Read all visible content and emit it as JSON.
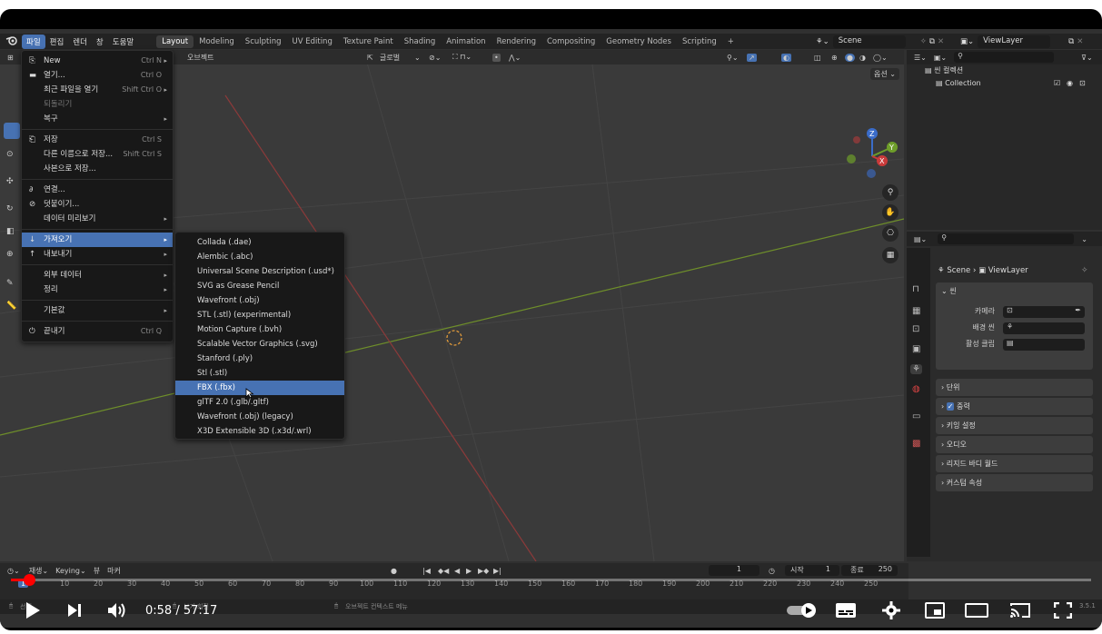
{
  "topbar": {
    "menus": [
      "파일",
      "편집",
      "렌더",
      "창",
      "도움말"
    ],
    "workspaces": [
      "Layout",
      "Modeling",
      "Sculpting",
      "UV Editing",
      "Texture Paint",
      "Shading",
      "Animation",
      "Rendering",
      "Compositing",
      "Geometry Nodes",
      "Scripting",
      "+"
    ],
    "scene": "Scene",
    "view_layer": "ViewLayer"
  },
  "viewport": {
    "object_menu": "오브젝트",
    "orientation": "글로벌",
    "options": "옵션"
  },
  "file_menu": {
    "items": [
      {
        "label": "New",
        "shortcut": "Ctrl N",
        "arrow": "▸"
      },
      {
        "label": "열기...",
        "shortcut": "Ctrl O"
      },
      {
        "label": "최근 파일을 열기",
        "shortcut": "Shift Ctrl O",
        "arrow": "▸"
      },
      {
        "label": "되돌리기"
      },
      {
        "label": "복구",
        "arrow": "▸"
      },
      {
        "label": "저장",
        "shortcut": "Ctrl S"
      },
      {
        "label": "다른 이름으로 저장...",
        "shortcut": "Shift Ctrl S"
      },
      {
        "label": "사본으로 저장..."
      },
      {
        "label": "연결..."
      },
      {
        "label": "덧붙이기..."
      },
      {
        "label": "데이터 미리보기",
        "arrow": "▸"
      },
      {
        "label": "가져오기",
        "arrow": "▸"
      },
      {
        "label": "내보내기",
        "arrow": "▸"
      },
      {
        "label": "외부 데이터",
        "arrow": "▸"
      },
      {
        "label": "정리",
        "arrow": "▸"
      },
      {
        "label": "기본값",
        "arrow": "▸"
      },
      {
        "label": "끝내기",
        "shortcut": "Ctrl Q"
      }
    ]
  },
  "import_menu": {
    "items": [
      "Collada (.dae)",
      "Alembic (.abc)",
      "Universal Scene Description (.usd*)",
      "SVG as Grease Pencil",
      "Wavefront (.obj)",
      "STL (.stl) (experimental)",
      "Motion Capture (.bvh)",
      "Scalable Vector Graphics (.svg)",
      "Stanford (.ply)",
      "Stl (.stl)",
      "FBX (.fbx)",
      "glTF 2.0 (.glb/.gltf)",
      "Wavefront (.obj) (legacy)",
      "X3D Extensible 3D (.x3d/.wrl)"
    ],
    "highlighted": "FBX (.fbx)"
  },
  "outliner": {
    "root": "씬 컬렉션",
    "collection": "Collection"
  },
  "properties": {
    "breadcrumb_scene": "Scene",
    "breadcrumb_viewlayer": "ViewLayer",
    "section": "씬",
    "camera_label": "카메라",
    "bg_scene_label": "배경 씬",
    "active_clip_label": "활성 클립",
    "panels": [
      "단위",
      "중력",
      "키잉 설정",
      "오디오",
      "리지드 바디 월드",
      "커스텀 속성"
    ]
  },
  "timeline": {
    "playback": "재생",
    "keying": "Keying",
    "view": "뷰",
    "marker": "마커",
    "current_frame": "1",
    "start_label": "시작",
    "start": "1",
    "end_label": "종료",
    "end": "250",
    "ticks": [
      "10",
      "20",
      "30",
      "40",
      "50",
      "60",
      "70",
      "80",
      "90",
      "100",
      "110",
      "120",
      "130",
      "140",
      "150",
      "160",
      "170",
      "180",
      "190",
      "200",
      "210",
      "220",
      "230",
      "240",
      "250"
    ]
  },
  "statusbar": {
    "left": "선택",
    "mid": "보기 회전",
    "context": "오브젝트 컨텍스트 메뉴",
    "version": "3.5.1"
  },
  "video": {
    "time": "0:58 / 57:17",
    "progress_fraction": 0.017
  },
  "colors": {
    "highlight": "#4772b3",
    "progress": "#ff0000"
  }
}
